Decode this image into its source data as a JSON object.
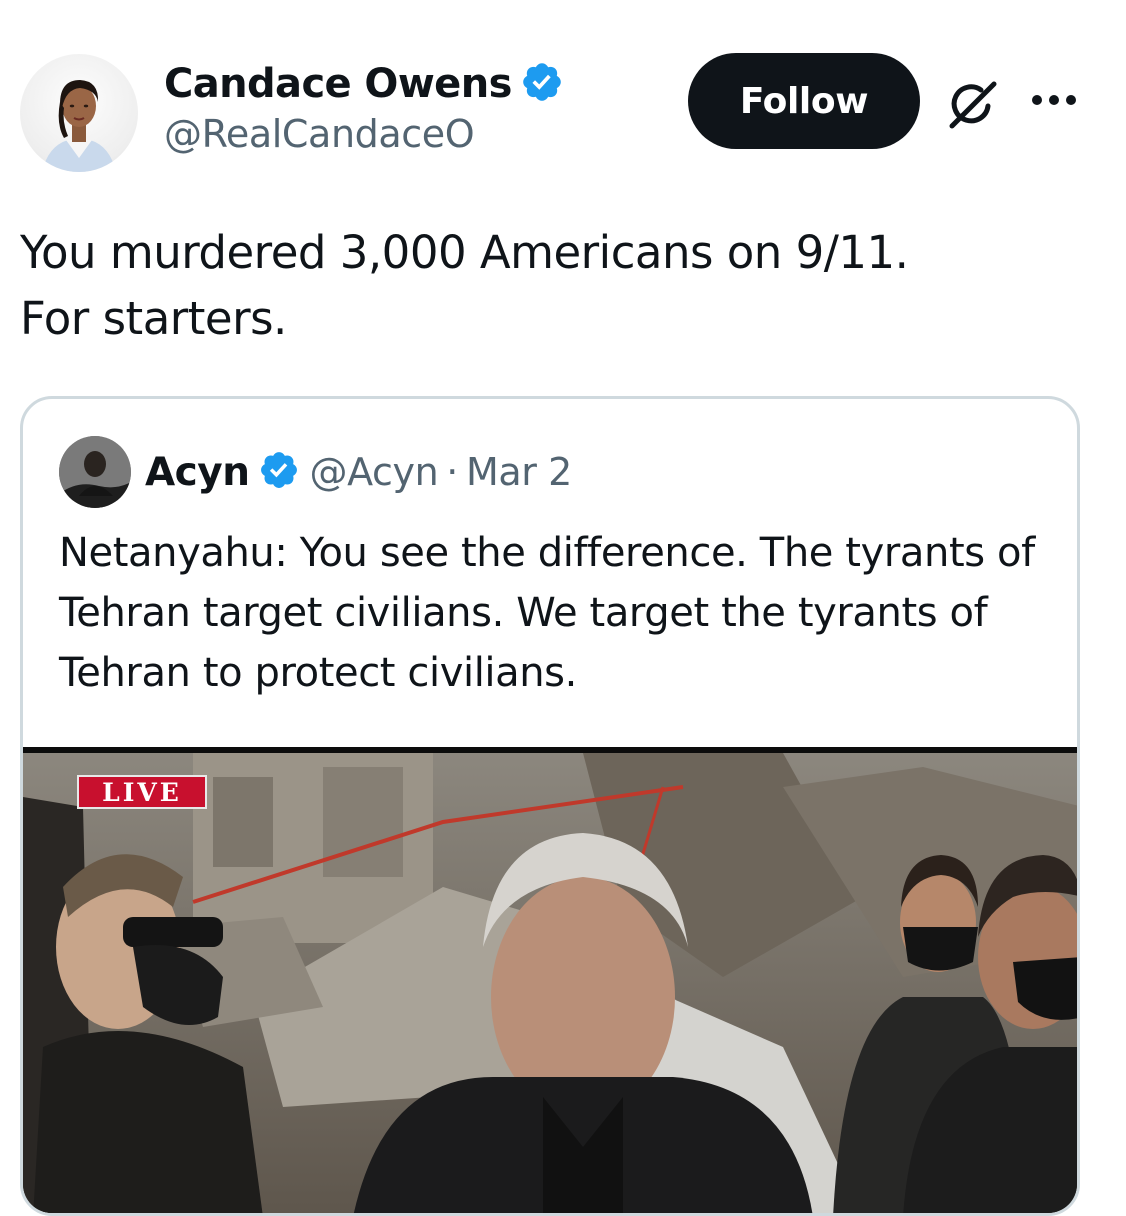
{
  "author": {
    "name": "Candace Owens",
    "handle": "@RealCandaceO",
    "verified": true
  },
  "actions": {
    "follow_label": "Follow",
    "grok_icon": "grok-icon",
    "more_icon": "more-options-icon"
  },
  "tweet": {
    "text": "You murdered 3,000 Americans on 9/11.\nFor starters."
  },
  "quote": {
    "name": "Acyn",
    "handle": "@Acyn",
    "separator": "·",
    "date": "Mar 2",
    "text": "Netanyahu: You see the difference. The tyrants of Tehran target civilians. We target the tyrants of Tehran to protect civilians.",
    "media": {
      "badge": "LIVE"
    }
  },
  "colors": {
    "text": "#0f1419",
    "secondary": "#536471",
    "verified": "#1d9bf0",
    "follow_bg": "#0f1419",
    "border": "#cfd9de",
    "live_badge": "#c8102e"
  }
}
